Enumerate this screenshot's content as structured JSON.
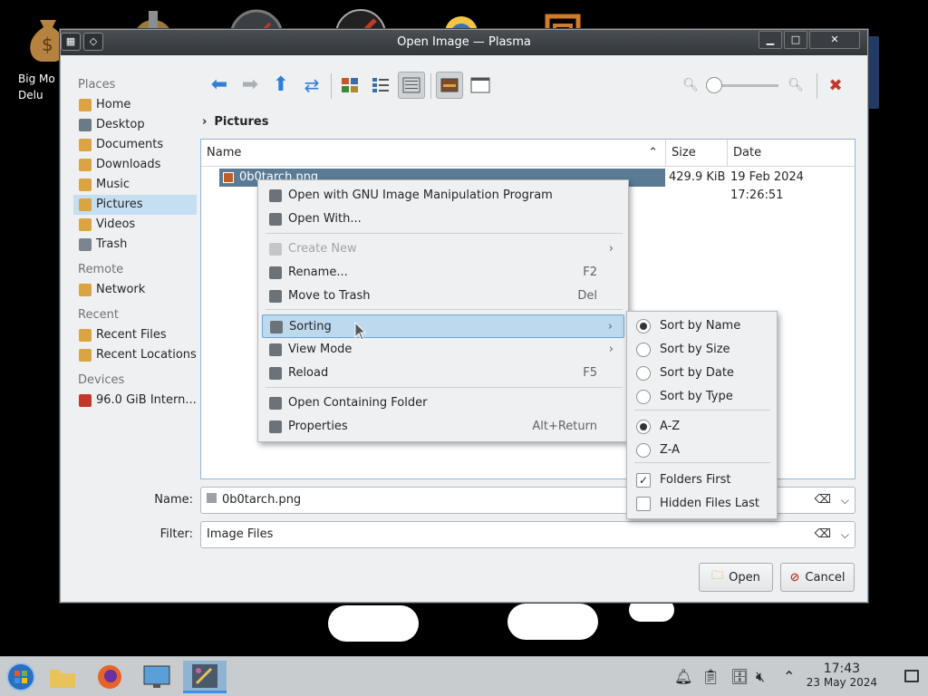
{
  "desktop": {
    "icon_label": "Big Mo\nDelu"
  },
  "window": {
    "title": "Open Image — Plasma",
    "minimize": "▁",
    "maximize": "□",
    "close": "✕"
  },
  "places": {
    "sections": [
      {
        "heading": "Places",
        "items": [
          {
            "label": "Home",
            "icon": "home-folder-icon",
            "color": "#d9a441"
          },
          {
            "label": "Desktop",
            "icon": "desktop-icon",
            "color": "#6c7a86"
          },
          {
            "label": "Documents",
            "icon": "documents-icon",
            "color": "#d9a441"
          },
          {
            "label": "Downloads",
            "icon": "downloads-icon",
            "color": "#d9a441"
          },
          {
            "label": "Music",
            "icon": "music-icon",
            "color": "#d9a441"
          },
          {
            "label": "Pictures",
            "icon": "pictures-icon",
            "color": "#d9a441",
            "selected": true
          },
          {
            "label": "Videos",
            "icon": "videos-icon",
            "color": "#d9a441"
          },
          {
            "label": "Trash",
            "icon": "trash-icon",
            "color": "#7a8590"
          }
        ]
      },
      {
        "heading": "Remote",
        "items": [
          {
            "label": "Network",
            "icon": "network-icon",
            "color": "#d9a441"
          }
        ]
      },
      {
        "heading": "Recent",
        "items": [
          {
            "label": "Recent Files",
            "icon": "recent-files-icon",
            "color": "#d9a441"
          },
          {
            "label": "Recent Locations",
            "icon": "recent-locations-icon",
            "color": "#d9a441"
          }
        ]
      },
      {
        "heading": "Devices",
        "items": [
          {
            "label": "96.0 GiB Intern...",
            "icon": "drive-icon",
            "color": "#c0392b"
          }
        ]
      }
    ]
  },
  "breadcrumb": {
    "separator": "›",
    "current": "Pictures"
  },
  "fileview": {
    "columns": [
      "Name",
      "Size",
      "Date"
    ],
    "sort_indicator": "⌃",
    "rows": [
      {
        "name": "0b0tarch.png",
        "size": "429.9 KiB",
        "date": "19 Feb 2024 17:26:51"
      }
    ]
  },
  "context_menu": {
    "items": [
      {
        "label": "Open with GNU Image Manipulation Program",
        "icon": "gimp-icon"
      },
      {
        "label": "Open With...",
        "icon": "open-with-icon"
      },
      {
        "label": "Create New",
        "icon": "create-new-icon",
        "disabled": true,
        "submenu": true
      },
      {
        "label": "Rename...",
        "icon": "rename-icon",
        "shortcut": "F2"
      },
      {
        "label": "Move to Trash",
        "icon": "trash-icon",
        "shortcut": "Del"
      },
      {
        "label": "Sorting",
        "icon": "sorting-icon",
        "submenu": true,
        "highlighted": true
      },
      {
        "label": "View Mode",
        "icon": "view-mode-icon",
        "submenu": true
      },
      {
        "label": "Reload",
        "icon": "reload-icon",
        "shortcut": "F5"
      },
      {
        "label": "Open Containing Folder",
        "icon": "folder-icon"
      },
      {
        "label": "Properties",
        "icon": "properties-icon",
        "shortcut": "Alt+Return"
      }
    ],
    "submenu_arrow": "›"
  },
  "sorting_submenu": {
    "items": [
      {
        "label": "Sort by Name",
        "type": "radio",
        "checked": true
      },
      {
        "label": "Sort by Size",
        "type": "radio",
        "checked": false
      },
      {
        "label": "Sort by Date",
        "type": "radio",
        "checked": false
      },
      {
        "label": "Sort by Type",
        "type": "radio",
        "checked": false
      },
      {
        "label": "A-Z",
        "type": "radio",
        "checked": true
      },
      {
        "label": "Z-A",
        "type": "radio",
        "checked": false
      },
      {
        "label": "Folders First",
        "type": "checkbox",
        "checked": true
      },
      {
        "label": "Hidden Files Last",
        "type": "checkbox",
        "checked": false
      }
    ],
    "check_mark": "✓"
  },
  "form": {
    "name_label": "Name:",
    "name_value": "0b0tarch.png",
    "filter_label": "Filter:",
    "filter_value": "Image Files",
    "clear_glyph": "⌫",
    "dropdown_glyph": "⌵"
  },
  "buttons": {
    "open": "Open",
    "cancel": "Cancel"
  },
  "taskbar": {
    "time": "17:43",
    "date": "23 May 2024"
  },
  "colors": {
    "accent": "#3d8ee6",
    "selection": "#c4dff2",
    "file_selection": "#5b7b94"
  }
}
